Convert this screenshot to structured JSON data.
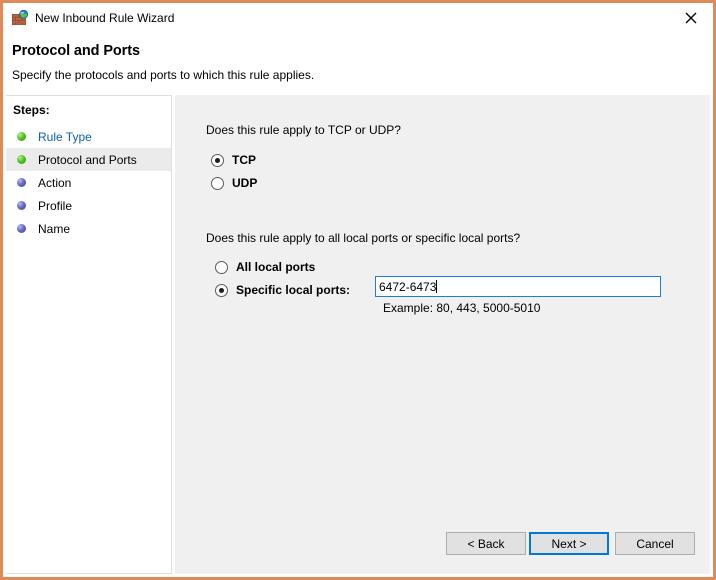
{
  "window": {
    "title": "New Inbound Rule Wizard",
    "icon": "firewall-globe-icon",
    "close_label": "✕",
    "border_color": "#e08a5a"
  },
  "header": {
    "title": "Protocol and Ports",
    "subtitle": "Specify the protocols and ports to which this rule applies."
  },
  "sidebar": {
    "heading": "Steps:",
    "items": [
      {
        "label": "Rule Type",
        "state": "done",
        "is_link": true,
        "current": false
      },
      {
        "label": "Protocol and Ports",
        "state": "done",
        "is_link": false,
        "current": true
      },
      {
        "label": "Action",
        "state": "pending",
        "is_link": false,
        "current": false
      },
      {
        "label": "Profile",
        "state": "pending",
        "is_link": false,
        "current": false
      },
      {
        "label": "Name",
        "state": "pending",
        "is_link": false,
        "current": false
      }
    ]
  },
  "main": {
    "protocol": {
      "question": "Does this rule apply to TCP or UDP?",
      "options": [
        {
          "label": "TCP",
          "checked": true
        },
        {
          "label": "UDP",
          "checked": false
        }
      ]
    },
    "ports": {
      "question": "Does this rule apply to all local ports or specific local ports?",
      "options": [
        {
          "label": "All local ports",
          "checked": false
        },
        {
          "label": "Specific local ports:",
          "checked": true
        }
      ],
      "input_value": "6472-6473",
      "input_placeholder": "",
      "example": "Example: 80, 443, 5000-5010"
    }
  },
  "footer": {
    "buttons": [
      {
        "label": "< Back",
        "default": false
      },
      {
        "label": "Next >",
        "default": true
      },
      {
        "label": "Cancel",
        "default": false
      }
    ]
  }
}
